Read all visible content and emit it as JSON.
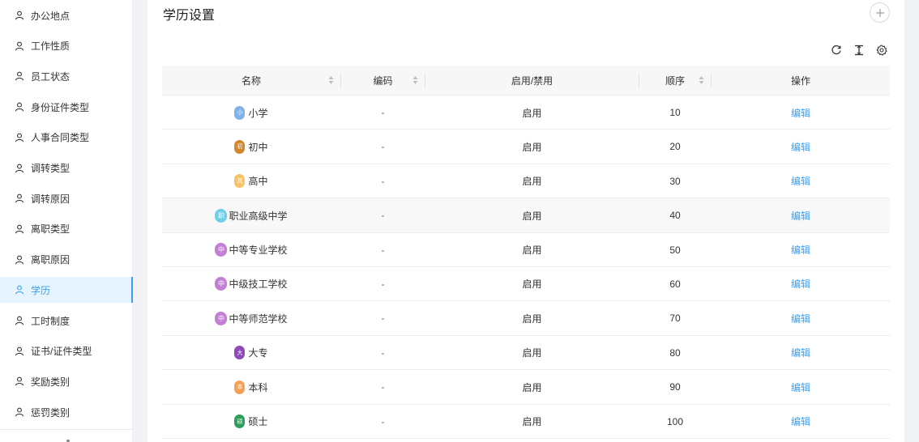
{
  "sidebar": {
    "items": [
      {
        "label": "办公地点",
        "active": false
      },
      {
        "label": "工作性质",
        "active": false
      },
      {
        "label": "员工状态",
        "active": false
      },
      {
        "label": "身份证件类型",
        "active": false
      },
      {
        "label": "人事合同类型",
        "active": false
      },
      {
        "label": "调转类型",
        "active": false
      },
      {
        "label": "调转原因",
        "active": false
      },
      {
        "label": "离职类型",
        "active": false
      },
      {
        "label": "离职原因",
        "active": false
      },
      {
        "label": "学历",
        "active": true
      },
      {
        "label": "工时制度",
        "active": false
      },
      {
        "label": "证书/证件类型",
        "active": false
      },
      {
        "label": "奖励类别",
        "active": false
      },
      {
        "label": "惩罚类别",
        "active": false
      }
    ]
  },
  "page": {
    "title": "学历设置"
  },
  "toolbar": {
    "icons": [
      "refresh-icon",
      "column-height-icon",
      "settings-icon"
    ]
  },
  "table": {
    "columns": {
      "name": "名称",
      "code": "编码",
      "status": "启用/禁用",
      "order": "顺序",
      "action": "操作"
    },
    "rows": [
      {
        "avatar": "小",
        "avatar_color": "#7fb2ea",
        "name": "小学",
        "code": "-",
        "status": "启用",
        "order": "10",
        "action": "编辑"
      },
      {
        "avatar": "初",
        "avatar_color": "#d4862a",
        "name": "初中",
        "code": "-",
        "status": "启用",
        "order": "20",
        "action": "编辑"
      },
      {
        "avatar": "高",
        "avatar_color": "#f7c26a",
        "name": "高中",
        "code": "-",
        "status": "启用",
        "order": "30",
        "action": "编辑"
      },
      {
        "avatar": "职",
        "avatar_color": "#6ecfe6",
        "name": "职业高级中学",
        "code": "-",
        "status": "启用",
        "order": "40",
        "action": "编辑"
      },
      {
        "avatar": "中",
        "avatar_color": "#c37fd4",
        "name": "中等专业学校",
        "code": "-",
        "status": "启用",
        "order": "50",
        "action": "编辑"
      },
      {
        "avatar": "中",
        "avatar_color": "#c37fd4",
        "name": "中级技工学校",
        "code": "-",
        "status": "启用",
        "order": "60",
        "action": "编辑"
      },
      {
        "avatar": "中",
        "avatar_color": "#c37fd4",
        "name": "中等师范学校",
        "code": "-",
        "status": "启用",
        "order": "70",
        "action": "编辑"
      },
      {
        "avatar": "大",
        "avatar_color": "#8e4bb8",
        "name": "大专",
        "code": "-",
        "status": "启用",
        "order": "80",
        "action": "编辑"
      },
      {
        "avatar": "本",
        "avatar_color": "#f4a25a",
        "name": "本科",
        "code": "-",
        "status": "启用",
        "order": "90",
        "action": "编辑"
      },
      {
        "avatar": "硕",
        "avatar_color": "#2e9e5a",
        "name": "硕士",
        "code": "-",
        "status": "启用",
        "order": "100",
        "action": "编辑"
      }
    ]
  },
  "colors": {
    "accent": "#3b9ff0",
    "active_bg": "#e6f4fd"
  }
}
